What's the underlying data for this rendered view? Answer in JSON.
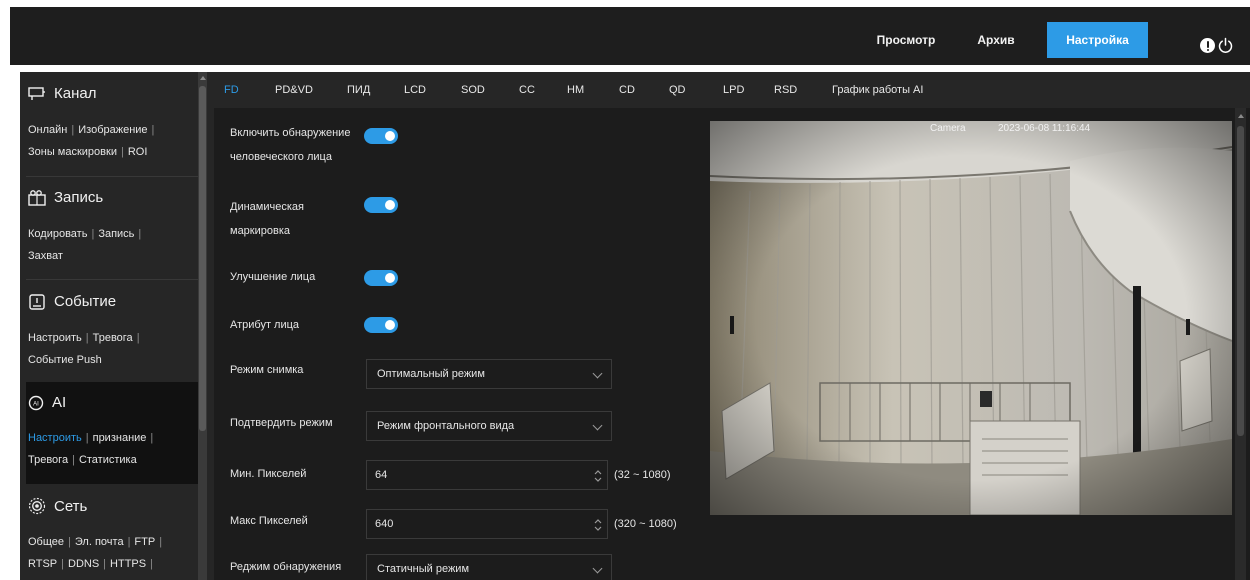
{
  "topnav": {
    "items": [
      "Просмотр",
      "Архив",
      "Настройка"
    ],
    "active": "Настройка"
  },
  "sidebar": {
    "sections": [
      {
        "title": "Канал",
        "icon": "channel-icon",
        "lines": [
          [
            "Онлайн",
            "Изображение"
          ],
          [
            "Зоны маскировки",
            "ROI"
          ]
        ]
      },
      {
        "title": "Запись",
        "icon": "record-icon",
        "lines": [
          [
            "Кодировать",
            "Запись"
          ],
          [
            "Захват"
          ]
        ]
      },
      {
        "title": "Событие",
        "icon": "event-icon",
        "lines": [
          [
            "Настроить",
            "Тревога"
          ],
          [
            "Событие Push"
          ]
        ]
      },
      {
        "title": "AI",
        "icon": "ai-icon",
        "lines": [
          [
            "Настроить",
            "признание"
          ],
          [
            "Тревога",
            "Статистика"
          ]
        ],
        "active_link": "Настроить"
      },
      {
        "title": "Сеть",
        "icon": "network-icon",
        "lines": [
          [
            "Общее",
            "Эл. почта",
            "FTP"
          ],
          [
            "RTSP",
            "DDNS",
            "HTTPS"
          ]
        ]
      }
    ]
  },
  "tabs": {
    "items": [
      "FD",
      "PD&VD",
      "ПИД",
      "LCD",
      "SOD",
      "CC",
      "HM",
      "CD",
      "QD",
      "LPD",
      "RSD",
      "График работы AI"
    ],
    "active": "FD"
  },
  "form": {
    "face_detect_label_1": "Включить обнаружение",
    "face_detect_label_2": "человеческого лица",
    "face_detect_on": true,
    "dynamic_marking_label_1": "Динамическая",
    "dynamic_marking_label_2": "маркировка",
    "dynamic_marking_on": true,
    "face_enhance_label": "Улучшение лица",
    "face_enhance_on": true,
    "face_attr_label": "Атрибут лица",
    "face_attr_on": true,
    "snap_mode_label": "Режим снимка",
    "snap_mode_value": "Оптимальный режим",
    "confirm_mode_label": "Подтвердить режим",
    "confirm_mode_value": "Режим фронтального вида",
    "min_pixels_label": "Мин. Пикселей",
    "min_pixels_value": "64",
    "min_pixels_range": "(32 ~ 1080)",
    "max_pixels_label": "Макс Пикселей",
    "max_pixels_value": "640",
    "max_pixels_range": "(320 ~ 1080)",
    "detect_mode_label": "Реджим обнаружения",
    "detect_mode_value": "Статичный режим"
  },
  "video": {
    "osd_name": "Camera",
    "osd_time": "2023-06-08 11:16:44"
  },
  "colors": {
    "accent": "#2d9be6",
    "topbar_bg": "#1e1e1e",
    "sidebar_bg": "#262626",
    "panel_bg": "#1c1c1c",
    "text": "#e6e6e6"
  }
}
